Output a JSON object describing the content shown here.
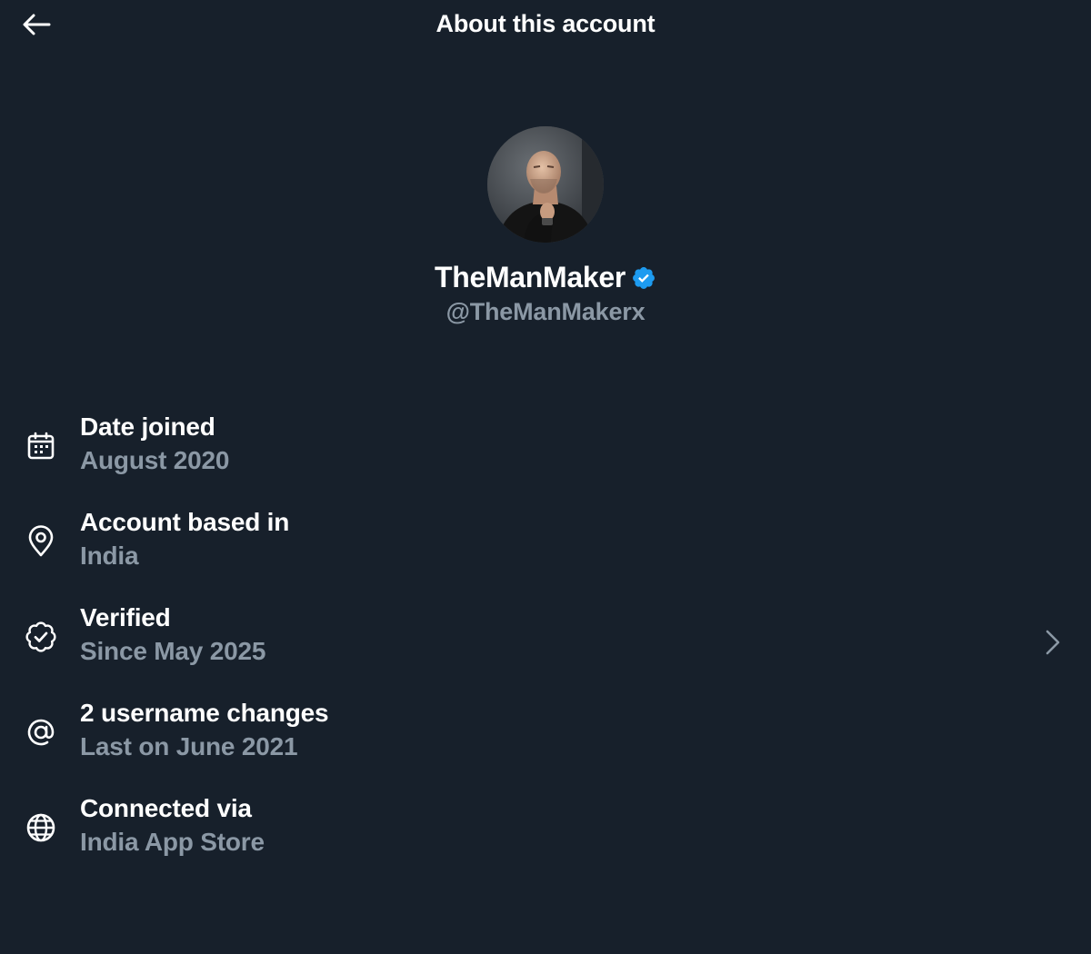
{
  "header": {
    "title": "About this account",
    "back_icon": "arrow-left-icon"
  },
  "profile": {
    "avatar_icon": "avatar-photo",
    "display_name": "TheManMaker",
    "verified_badge_icon": "verified-badge-icon",
    "handle": "@TheManMakerx"
  },
  "info": [
    {
      "icon": "calendar-icon",
      "title": "Date joined",
      "value": "August 2020"
    },
    {
      "icon": "location-pin-icon",
      "title": "Account based in",
      "value": "India"
    },
    {
      "icon": "verified-check-icon",
      "title": "Verified",
      "value": "Since May 2025",
      "has_chevron": true
    },
    {
      "icon": "at-sign-icon",
      "title": "2 username changes",
      "value": "Last on June 2021"
    },
    {
      "icon": "globe-icon",
      "title": "Connected via",
      "value": "India App Store"
    }
  ],
  "colors": {
    "background": "#17202b",
    "primary_text": "#ffffff",
    "secondary_text": "#8b98a5",
    "verified_blue": "#1d9bf0"
  }
}
